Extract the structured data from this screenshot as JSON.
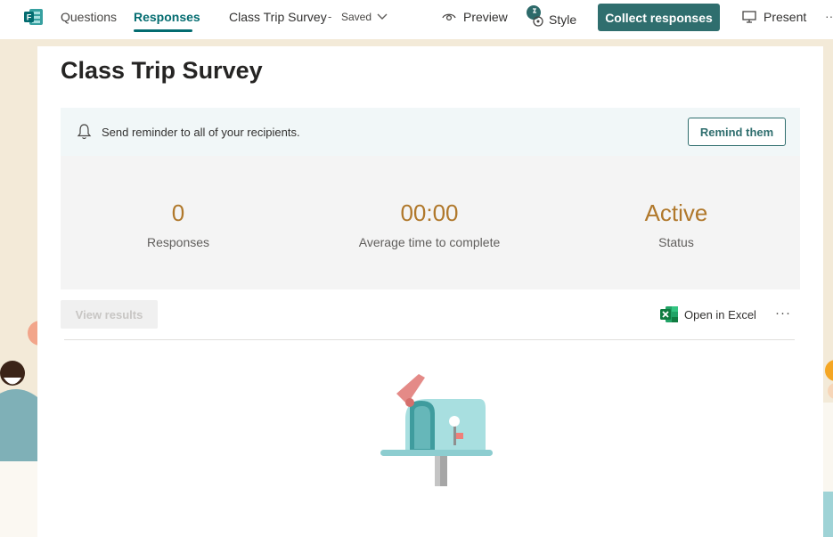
{
  "header": {
    "tabs": [
      {
        "label": "Questions",
        "active": false
      },
      {
        "label": "Responses",
        "active": true
      }
    ],
    "form_title": "Class Trip Survey",
    "separator": "-",
    "save_status": "Saved",
    "preview_label": "Preview",
    "style_label": "Style",
    "collect_label": "Collect responses",
    "present_label": "Present",
    "more_label": "··"
  },
  "page": {
    "title": "Class Trip Survey"
  },
  "reminder": {
    "text": "Send reminder to all of your recipients.",
    "button_label": "Remind them"
  },
  "stats": [
    {
      "value": "0",
      "label": "Responses"
    },
    {
      "value": "00:00",
      "label": "Average time to complete"
    },
    {
      "value": "Active",
      "label": "Status"
    }
  ],
  "actions": {
    "view_results_label": "View results",
    "open_excel_label": "Open in Excel",
    "more_label": "···"
  },
  "colors": {
    "accent": "#2f6e6e",
    "stat_value": "#b0782b",
    "reminder_bg": "#f1f7f8"
  },
  "icons": {
    "app": "forms-logo-icon",
    "preview": "eye-icon",
    "style": "palette-icon",
    "present": "monitor-icon",
    "bell": "bell-icon",
    "excel": "excel-icon",
    "mailbox": "mailbox-illustration"
  }
}
